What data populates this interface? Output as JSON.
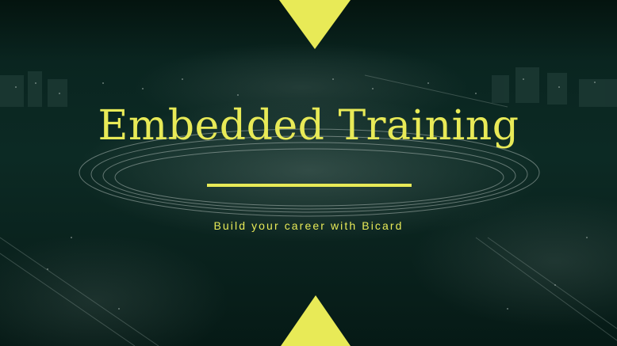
{
  "slide": {
    "title": "Embedded Training",
    "subtitle": "Build your career with Bicard"
  },
  "colors": {
    "accent": "#e8ea57",
    "background": "#061a16"
  }
}
